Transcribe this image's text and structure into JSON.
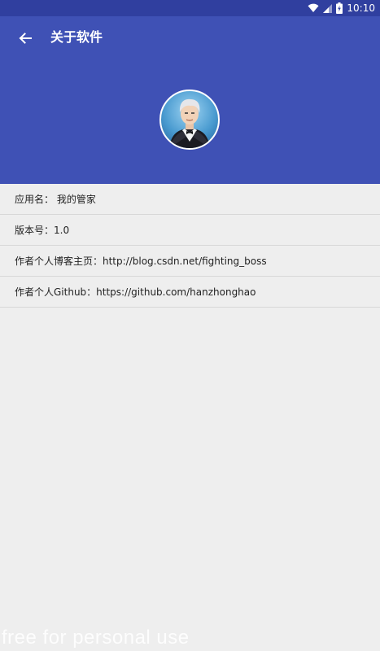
{
  "status_bar": {
    "time": "10:10",
    "icons": [
      "wifi-icon",
      "cell-signal-icon",
      "battery-icon"
    ]
  },
  "app_bar": {
    "back_icon": "arrow-left-icon",
    "title": "关于软件",
    "color": "#3f51b5",
    "status_color": "#303f9f"
  },
  "profile": {
    "avatar": "avatar"
  },
  "info_list": [
    {
      "text": "应用名： 我的管家"
    },
    {
      "text": "版本号：1.0"
    },
    {
      "text": "作者个人博客主页：http://blog.csdn.net/fighting_boss"
    },
    {
      "text": "作者个人Github：https://github.com/hanzhonghao"
    }
  ],
  "watermark": "free for personal use"
}
